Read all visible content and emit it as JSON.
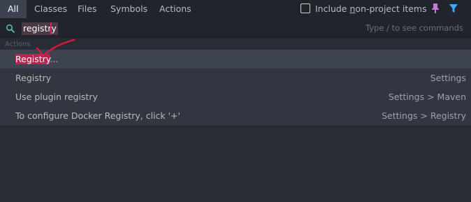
{
  "tabs": [
    {
      "label": "All",
      "active": true
    },
    {
      "label": "Classes"
    },
    {
      "label": "Files"
    },
    {
      "label": "Symbols"
    },
    {
      "label": "Actions"
    }
  ],
  "include_non_project": {
    "label_pre": "Include ",
    "label_mnemonic": "n",
    "label_post": "on-project items",
    "checked": false
  },
  "icons": {
    "pin": "pin-icon",
    "filter": "filter-icon",
    "search": "search-icon"
  },
  "search": {
    "value": "registry",
    "hint": "Type / to see commands"
  },
  "group_label": "Actions",
  "results": [
    {
      "highlight": "Registry",
      "rest": "...",
      "meta": ""
    },
    {
      "highlight": "",
      "rest": "Registry",
      "meta": "Settings"
    },
    {
      "highlight": "",
      "rest": "Use plugin registry",
      "meta": "Settings > Maven"
    },
    {
      "highlight": "",
      "rest": "To configure Docker Registry, click '+'",
      "meta": "Settings > Registry"
    }
  ],
  "colors": {
    "accent": "#e0245e",
    "filter": "#3fa9f5",
    "pin": "#c678dd",
    "annotation": "#e0163a"
  }
}
